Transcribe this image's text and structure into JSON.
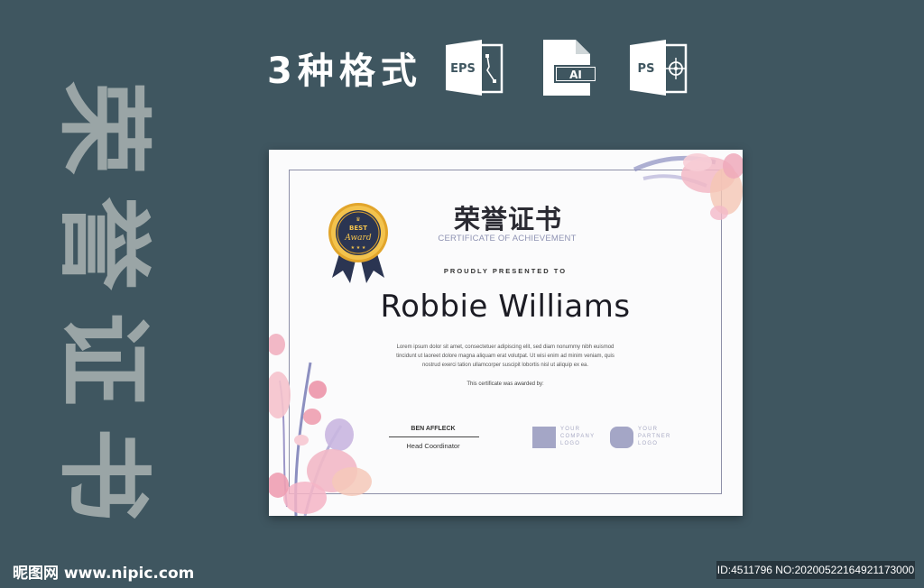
{
  "side_title": [
    "荣",
    "誉",
    "证",
    "书"
  ],
  "formats": {
    "label": "3种格式",
    "icons": [
      {
        "icon": "eps-file-icon",
        "text": "EPS"
      },
      {
        "icon": "ai-file-icon",
        "text": "AI"
      },
      {
        "icon": "ps-file-icon",
        "text": "PS"
      }
    ]
  },
  "certificate": {
    "title": "荣誉证书",
    "subtitle": "CERTIFICATE OF ACHIEVEMENT",
    "medal": {
      "line1": "BEST",
      "line2": "Award"
    },
    "presented_to": "PROUDLY PRESENTED TO",
    "recipient": "Robbie Williams",
    "body_lines": [
      "Lorem ipsum dolor sit amet, consectetuer adipiscing elit, sed diam nonummy nibh euismod",
      "tincidunt ut laoreet dolore magna aliquam erat volutpat. Ut wisi enim ad minim veniam, quis",
      "nostrud exerci tation ullamcorper suscipit lobortis nisl ut aliquip ex ea."
    ],
    "awarded_by": "This certificate was awarded by:",
    "signer_name": "BEN AFFLECK",
    "signer_role": "Head Coordinator",
    "logos": [
      {
        "lines": [
          "YOUR",
          "COMPANY",
          "LOGO"
        ]
      },
      {
        "lines": [
          "YOUR",
          "PARTNER",
          "LOGO"
        ]
      }
    ]
  },
  "footer": {
    "logo_text": "昵图网 www.nipic.com",
    "id_text": "ID:4511796 NO:20200522164921173000"
  },
  "colors": {
    "background": "#3f5660",
    "side_title": "#9aa5a6",
    "medal_gold": "#e2a52b",
    "medal_navy": "#2b3552",
    "logo_placeholder": "#a4a6c6",
    "flower_pink": "#f2b8c6",
    "flower_purple": "#8c8fc0"
  }
}
